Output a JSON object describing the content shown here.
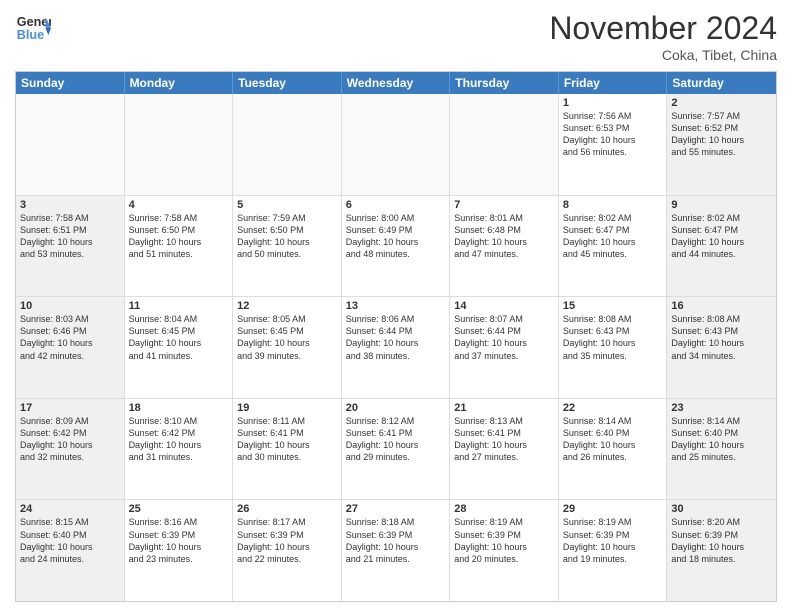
{
  "header": {
    "logo_line1": "General",
    "logo_line2": "Blue",
    "month": "November 2024",
    "location": "Coka, Tibet, China"
  },
  "weekdays": [
    "Sunday",
    "Monday",
    "Tuesday",
    "Wednesday",
    "Thursday",
    "Friday",
    "Saturday"
  ],
  "rows": [
    [
      {
        "day": "",
        "info": ""
      },
      {
        "day": "",
        "info": ""
      },
      {
        "day": "",
        "info": ""
      },
      {
        "day": "",
        "info": ""
      },
      {
        "day": "",
        "info": ""
      },
      {
        "day": "1",
        "info": "Sunrise: 7:56 AM\nSunset: 6:53 PM\nDaylight: 10 hours\nand 56 minutes."
      },
      {
        "day": "2",
        "info": "Sunrise: 7:57 AM\nSunset: 6:52 PM\nDaylight: 10 hours\nand 55 minutes."
      }
    ],
    [
      {
        "day": "3",
        "info": "Sunrise: 7:58 AM\nSunset: 6:51 PM\nDaylight: 10 hours\nand 53 minutes."
      },
      {
        "day": "4",
        "info": "Sunrise: 7:58 AM\nSunset: 6:50 PM\nDaylight: 10 hours\nand 51 minutes."
      },
      {
        "day": "5",
        "info": "Sunrise: 7:59 AM\nSunset: 6:50 PM\nDaylight: 10 hours\nand 50 minutes."
      },
      {
        "day": "6",
        "info": "Sunrise: 8:00 AM\nSunset: 6:49 PM\nDaylight: 10 hours\nand 48 minutes."
      },
      {
        "day": "7",
        "info": "Sunrise: 8:01 AM\nSunset: 6:48 PM\nDaylight: 10 hours\nand 47 minutes."
      },
      {
        "day": "8",
        "info": "Sunrise: 8:02 AM\nSunset: 6:47 PM\nDaylight: 10 hours\nand 45 minutes."
      },
      {
        "day": "9",
        "info": "Sunrise: 8:02 AM\nSunset: 6:47 PM\nDaylight: 10 hours\nand 44 minutes."
      }
    ],
    [
      {
        "day": "10",
        "info": "Sunrise: 8:03 AM\nSunset: 6:46 PM\nDaylight: 10 hours\nand 42 minutes."
      },
      {
        "day": "11",
        "info": "Sunrise: 8:04 AM\nSunset: 6:45 PM\nDaylight: 10 hours\nand 41 minutes."
      },
      {
        "day": "12",
        "info": "Sunrise: 8:05 AM\nSunset: 6:45 PM\nDaylight: 10 hours\nand 39 minutes."
      },
      {
        "day": "13",
        "info": "Sunrise: 8:06 AM\nSunset: 6:44 PM\nDaylight: 10 hours\nand 38 minutes."
      },
      {
        "day": "14",
        "info": "Sunrise: 8:07 AM\nSunset: 6:44 PM\nDaylight: 10 hours\nand 37 minutes."
      },
      {
        "day": "15",
        "info": "Sunrise: 8:08 AM\nSunset: 6:43 PM\nDaylight: 10 hours\nand 35 minutes."
      },
      {
        "day": "16",
        "info": "Sunrise: 8:08 AM\nSunset: 6:43 PM\nDaylight: 10 hours\nand 34 minutes."
      }
    ],
    [
      {
        "day": "17",
        "info": "Sunrise: 8:09 AM\nSunset: 6:42 PM\nDaylight: 10 hours\nand 32 minutes."
      },
      {
        "day": "18",
        "info": "Sunrise: 8:10 AM\nSunset: 6:42 PM\nDaylight: 10 hours\nand 31 minutes."
      },
      {
        "day": "19",
        "info": "Sunrise: 8:11 AM\nSunset: 6:41 PM\nDaylight: 10 hours\nand 30 minutes."
      },
      {
        "day": "20",
        "info": "Sunrise: 8:12 AM\nSunset: 6:41 PM\nDaylight: 10 hours\nand 29 minutes."
      },
      {
        "day": "21",
        "info": "Sunrise: 8:13 AM\nSunset: 6:41 PM\nDaylight: 10 hours\nand 27 minutes."
      },
      {
        "day": "22",
        "info": "Sunrise: 8:14 AM\nSunset: 6:40 PM\nDaylight: 10 hours\nand 26 minutes."
      },
      {
        "day": "23",
        "info": "Sunrise: 8:14 AM\nSunset: 6:40 PM\nDaylight: 10 hours\nand 25 minutes."
      }
    ],
    [
      {
        "day": "24",
        "info": "Sunrise: 8:15 AM\nSunset: 6:40 PM\nDaylight: 10 hours\nand 24 minutes."
      },
      {
        "day": "25",
        "info": "Sunrise: 8:16 AM\nSunset: 6:39 PM\nDaylight: 10 hours\nand 23 minutes."
      },
      {
        "day": "26",
        "info": "Sunrise: 8:17 AM\nSunset: 6:39 PM\nDaylight: 10 hours\nand 22 minutes."
      },
      {
        "day": "27",
        "info": "Sunrise: 8:18 AM\nSunset: 6:39 PM\nDaylight: 10 hours\nand 21 minutes."
      },
      {
        "day": "28",
        "info": "Sunrise: 8:19 AM\nSunset: 6:39 PM\nDaylight: 10 hours\nand 20 minutes."
      },
      {
        "day": "29",
        "info": "Sunrise: 8:19 AM\nSunset: 6:39 PM\nDaylight: 10 hours\nand 19 minutes."
      },
      {
        "day": "30",
        "info": "Sunrise: 8:20 AM\nSunset: 6:39 PM\nDaylight: 10 hours\nand 18 minutes."
      }
    ]
  ],
  "shaded_cols": [
    0,
    6
  ]
}
